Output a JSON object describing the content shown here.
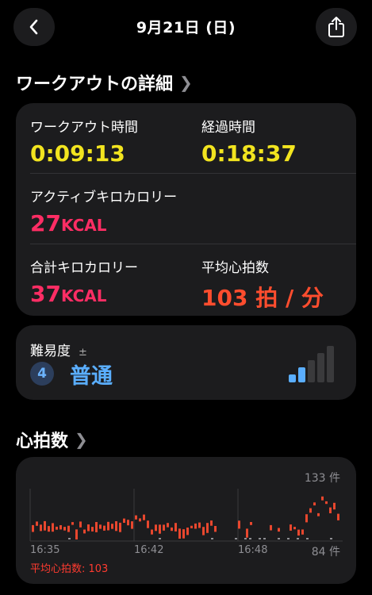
{
  "header": {
    "date": "9月21日 (日)"
  },
  "workout_section": {
    "title": "ワークアウトの詳細"
  },
  "summary": {
    "workout_time": {
      "label": "ワークアウト時間",
      "value": "0:09:13"
    },
    "elapsed_time": {
      "label": "経過時間",
      "value": "0:18:37"
    },
    "active_calories": {
      "label": "アクティブキロカロリー",
      "value": "27",
      "unit": "KCAL"
    },
    "total_calories": {
      "label": "合計キロカロリー",
      "value": "37",
      "unit": "KCAL"
    },
    "avg_heart_rate": {
      "label": "平均心拍数",
      "value": "103",
      "unit": "拍 / 分"
    }
  },
  "difficulty": {
    "label": "難易度",
    "symbol": "±",
    "level": "4",
    "level_text": "普通",
    "fraction": 0.4
  },
  "heart_section": {
    "title": "心拍数"
  },
  "heart_chart": {
    "max_label": "133 件",
    "min_label": "84 件",
    "ticks": [
      "16:35",
      "16:42",
      "16:48"
    ],
    "average_label": "平均心拍数: 103"
  },
  "colors": {
    "yellow": "#f2e41f",
    "pink": "#ff2d64",
    "orange": "#ff4d2e",
    "blue": "#5aaeff",
    "card": "#1c1c1e"
  }
}
